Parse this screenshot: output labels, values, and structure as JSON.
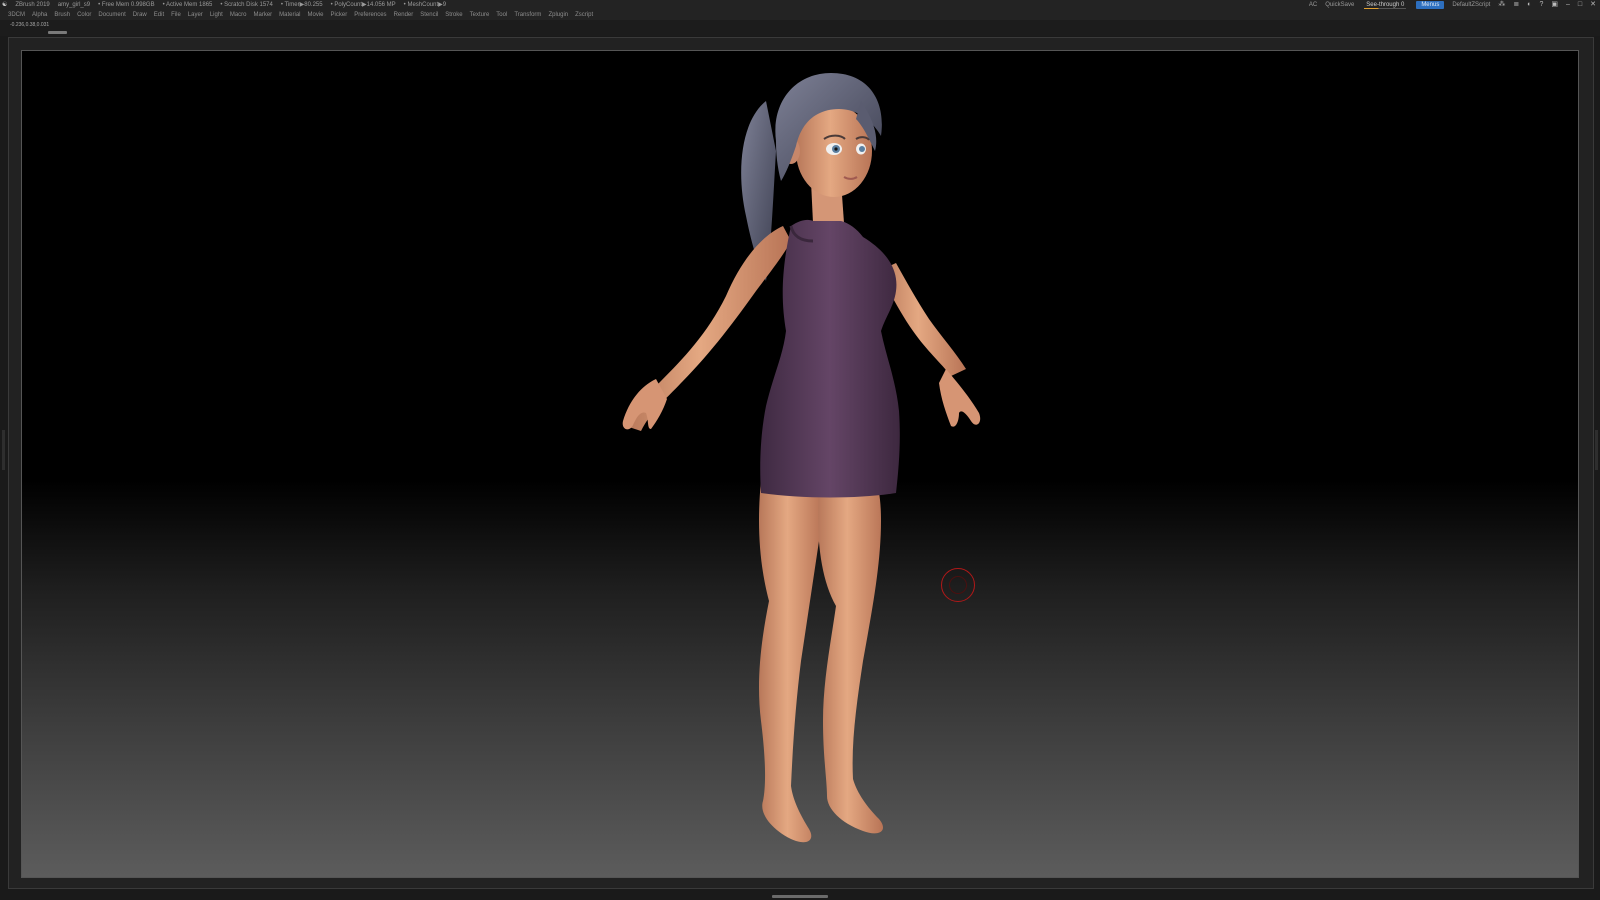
{
  "titlebar": {
    "app": "ZBrush 2019",
    "file": "amy_girl_s9",
    "free_mem": "• Free Mem 0.998GB",
    "active_mem": "• Active Mem 1865",
    "scratch": "• Scratch Disk 1574",
    "timer": "• Timer▶80.255",
    "polycount": "• PolyCount▶14.056 MP",
    "meshcount": "• MeshCount▶9",
    "ac": "AC",
    "quicksave": "QuickSave",
    "see_through": "See-through  0",
    "menus": "Menus",
    "script": "DefaultZScript"
  },
  "menus": [
    "3DCM",
    "Alpha",
    "Brush",
    "Color",
    "Document",
    "Draw",
    "Edit",
    "File",
    "Layer",
    "Light",
    "Macro",
    "Marker",
    "Material",
    "Movie",
    "Picker",
    "Preferences",
    "Render",
    "Stencil",
    "Stroke",
    "Texture",
    "Tool",
    "Transform",
    "Zplugin",
    "Zscript"
  ],
  "status": {
    "coords": "-0.236,0.38,0.031"
  },
  "colors": {
    "skin": "#e0a07c",
    "dress": "#5c3d5f",
    "hair": "#6c6f84",
    "cursor": "#b01818",
    "accent": "#2d6fbf"
  }
}
